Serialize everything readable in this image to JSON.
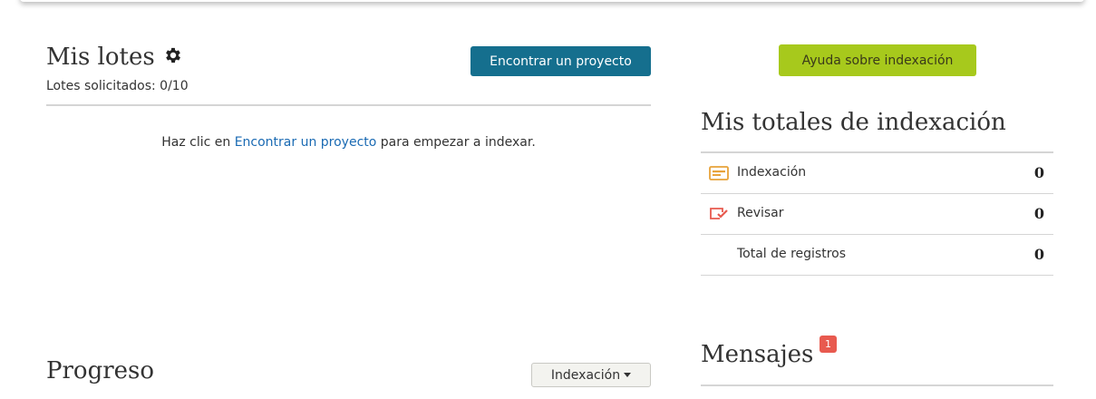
{
  "my_batches": {
    "title": "Mis lotes",
    "gear_icon": "gear-icon",
    "requested_label": "Lotes solicitados: 0/10",
    "find_project_button": "Encontrar un proyecto",
    "hint_before": "Haz clic en",
    "hint_link": "Encontrar un proyecto",
    "hint_after": "para empezar a indexar."
  },
  "progress": {
    "title": "Progreso",
    "dropdown_label": "Indexación"
  },
  "help_button": "Ayuda sobre indexación",
  "totals": {
    "title": "Mis totales de indexación",
    "rows": [
      {
        "label": "Indexación",
        "value": "0",
        "icon": "indexing-card-icon",
        "icon_color": "#e8a33a"
      },
      {
        "label": "Revisar",
        "value": "0",
        "icon": "review-check-icon",
        "icon_color": "#e85a4f"
      },
      {
        "label": "Total de registros",
        "value": "0",
        "icon": "",
        "icon_color": ""
      }
    ]
  },
  "messages": {
    "title": "Mensajes",
    "badge_count": "1",
    "badge_color": "#e85a4f"
  },
  "colors": {
    "primary_button": "#156f8e",
    "help_button": "#a7c91c",
    "link": "#1a6ab3"
  }
}
